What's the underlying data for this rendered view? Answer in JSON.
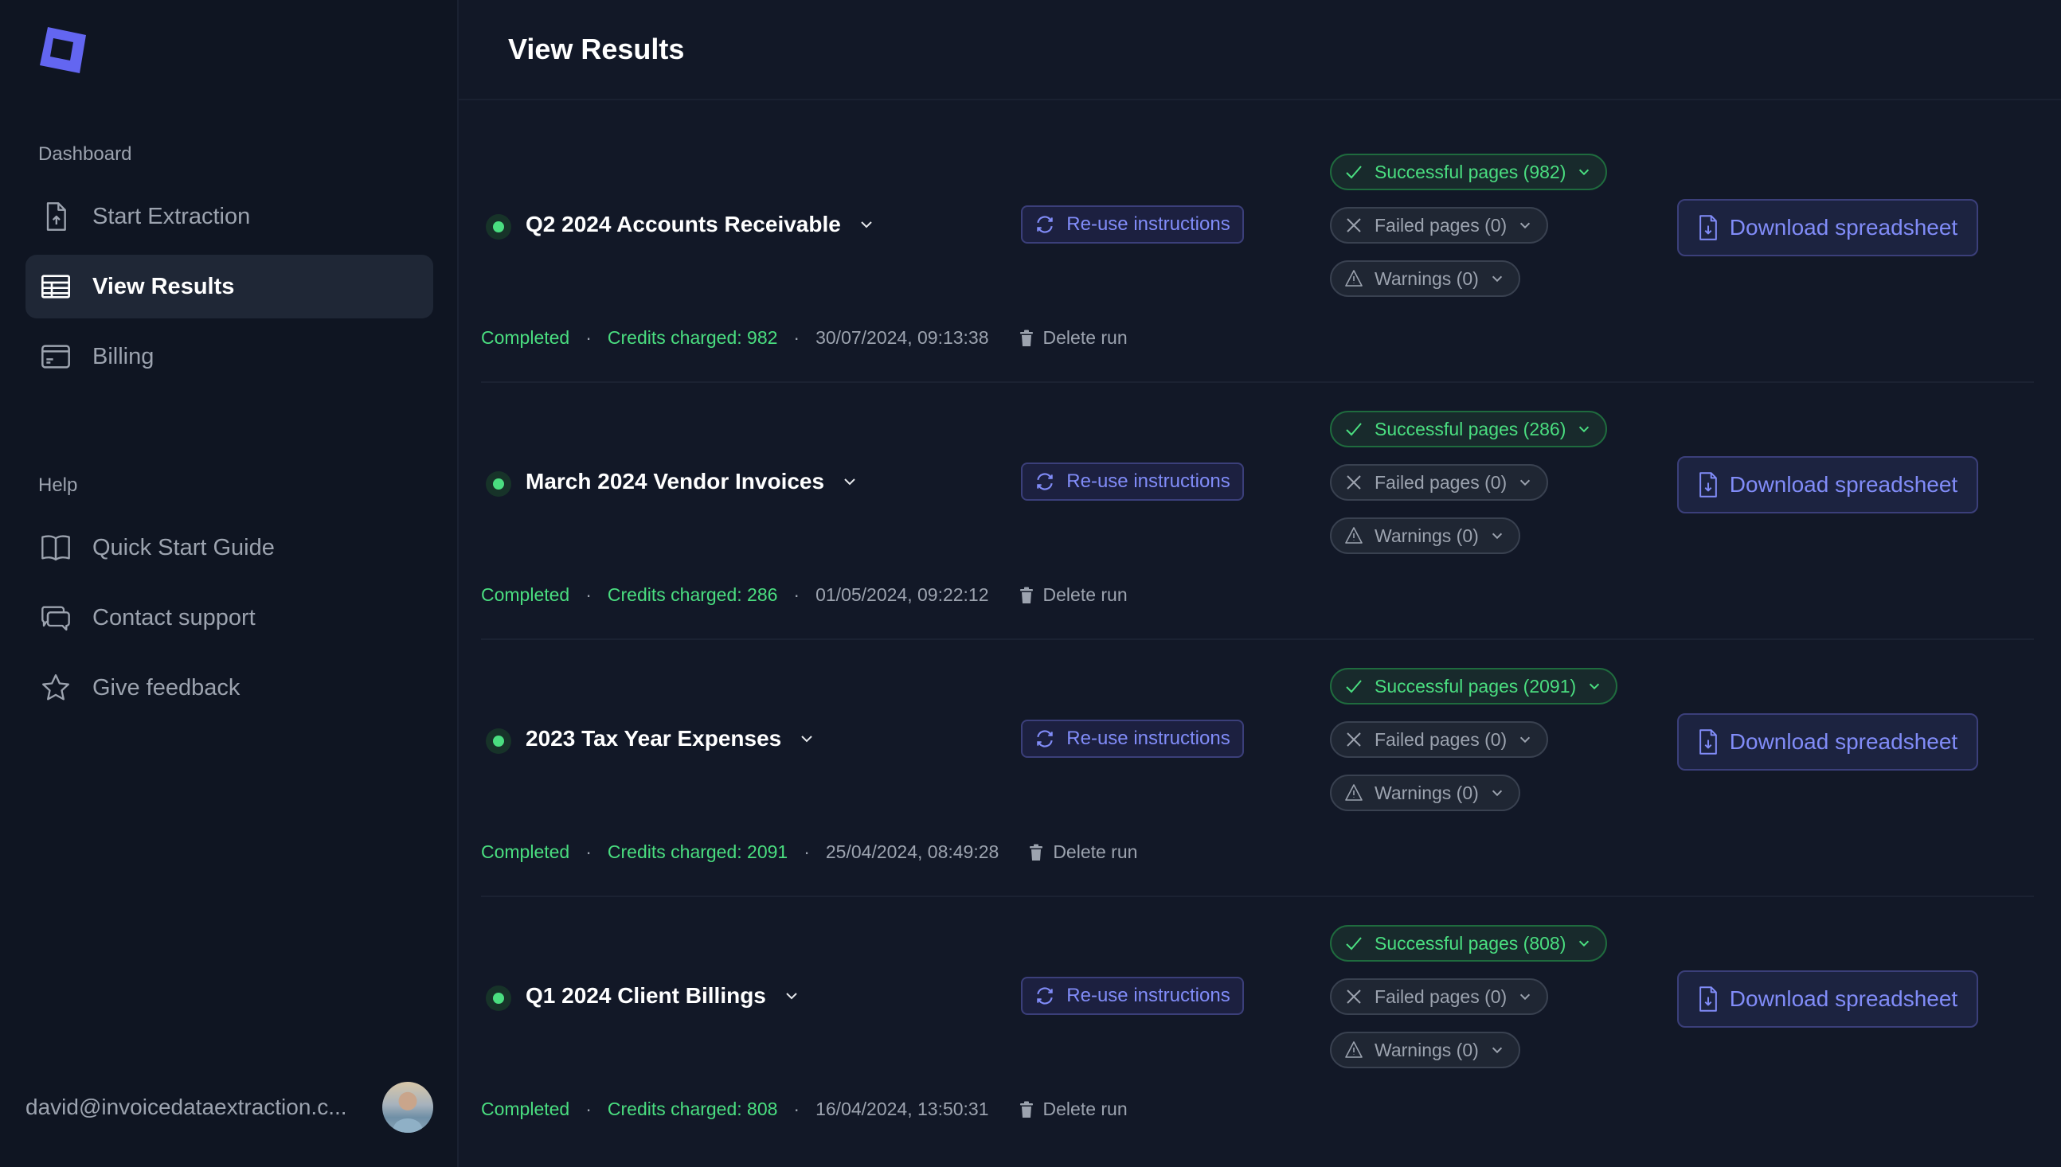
{
  "sidebar": {
    "logo": "app-logo",
    "sections": [
      {
        "label": "Dashboard",
        "items": [
          {
            "label": "Start Extraction",
            "icon": "file-upload-icon",
            "active": false
          },
          {
            "label": "View Results",
            "icon": "table-icon",
            "active": true
          },
          {
            "label": "Billing",
            "icon": "credit-card-icon",
            "active": false
          }
        ]
      },
      {
        "label": "Help",
        "items": [
          {
            "label": "Quick Start Guide",
            "icon": "book-icon",
            "active": false
          },
          {
            "label": "Contact support",
            "icon": "chat-bubbles-icon",
            "active": false
          },
          {
            "label": "Give feedback",
            "icon": "star-icon",
            "active": false
          }
        ]
      }
    ],
    "user": {
      "email": "david@invoicedataextraction.c..."
    }
  },
  "header": {
    "title": "View Results"
  },
  "colors": {
    "accent": "#818cf8",
    "success": "#4ade80",
    "muted": "#9ca3af",
    "background": "#121827",
    "sidebar_bg": "#0f1522"
  },
  "runs": [
    {
      "title": "Q2 2024 Accounts Receivable",
      "reuse_label": "Re-use instructions",
      "successful": "Successful pages (982)",
      "failed": "Failed pages (0)",
      "warnings": "Warnings (0)",
      "download_label": "Download spreadsheet",
      "status": "Completed",
      "credits": "Credits charged: 982",
      "date": "30/07/2024, 09:13:38",
      "delete_label": "Delete run"
    },
    {
      "title": "March 2024 Vendor Invoices",
      "reuse_label": "Re-use instructions",
      "successful": "Successful pages (286)",
      "failed": "Failed pages (0)",
      "warnings": "Warnings (0)",
      "download_label": "Download spreadsheet",
      "status": "Completed",
      "credits": "Credits charged: 286",
      "date": "01/05/2024, 09:22:12",
      "delete_label": "Delete run"
    },
    {
      "title": "2023 Tax Year Expenses",
      "reuse_label": "Re-use instructions",
      "successful": "Successful pages (2091)",
      "failed": "Failed pages (0)",
      "warnings": "Warnings (0)",
      "download_label": "Download spreadsheet",
      "status": "Completed",
      "credits": "Credits charged: 2091",
      "date": "25/04/2024, 08:49:28",
      "delete_label": "Delete run"
    },
    {
      "title": "Q1 2024 Client Billings",
      "reuse_label": "Re-use instructions",
      "successful": "Successful pages (808)",
      "failed": "Failed pages (0)",
      "warnings": "Warnings (0)",
      "download_label": "Download spreadsheet",
      "status": "Completed",
      "credits": "Credits charged: 808",
      "date": "16/04/2024, 13:50:31",
      "delete_label": "Delete run"
    }
  ]
}
